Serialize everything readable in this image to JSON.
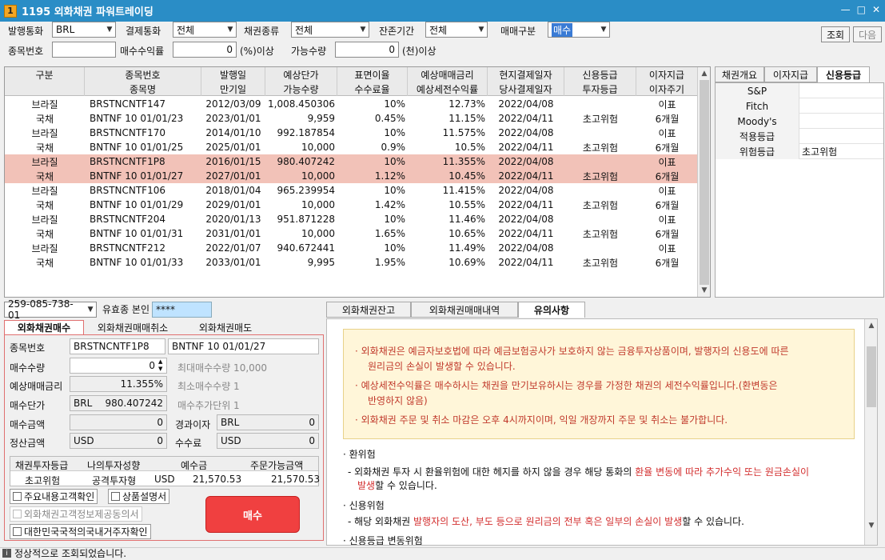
{
  "window": {
    "icon": "1",
    "title": "1195 외화채권 파워트레이딩",
    "minimize": "—",
    "restore": "□",
    "close": "✕"
  },
  "filters": {
    "issue_currency_label": "발행통화",
    "issue_currency_value": "BRL",
    "settle_currency_label": "결제통화",
    "settle_currency_value": "전체",
    "bond_type_label": "채권종류",
    "bond_type_value": "전체",
    "remaining_label": "잔존기간",
    "remaining_value": "전체",
    "trade_type_label": "매매구분",
    "trade_type_value": "매수",
    "code_label": "종목번호",
    "code_value": "",
    "yield_label": "매수수익률",
    "yield_value": "0",
    "yield_unit": "(%)이상",
    "qty_label": "가능수량",
    "qty_value": "0",
    "qty_unit": "(천)이상",
    "search_button": "조회",
    "next_button": "다음"
  },
  "grid": {
    "headers_top": [
      "구분",
      "종목번호",
      "발행일",
      "예상단가",
      "표면이율",
      "예상매매금리",
      "현지결제일자",
      "신용등급",
      "이자지급"
    ],
    "headers_bottom": [
      "",
      "종목명",
      "만기일",
      "가능수량",
      "수수료율",
      "예상세전수익률",
      "당사결제일자",
      "투자등급",
      "이자주기"
    ],
    "rows": [
      {
        "a": [
          "브라질",
          "BRSTNCNTF147",
          "2012/03/09",
          "1,008.450306",
          "10%",
          "12.73%",
          "2022/04/08",
          "",
          "이표"
        ],
        "b": [
          "국채",
          "BNTNF 10 01/01/23",
          "2023/01/01",
          "9,959",
          "0.45%",
          "11.15%",
          "2022/04/11",
          "초고위험",
          "6개월"
        ]
      },
      {
        "a": [
          "브라질",
          "BRSTNCNTF170",
          "2014/01/10",
          "992.187854",
          "10%",
          "11.575%",
          "2022/04/08",
          "",
          "이표"
        ],
        "b": [
          "국채",
          "BNTNF 10 01/01/25",
          "2025/01/01",
          "10,000",
          "0.9%",
          "10.5%",
          "2022/04/11",
          "초고위험",
          "6개월"
        ]
      },
      {
        "a": [
          "브라질",
          "BRSTNCNTF1P8",
          "2016/01/15",
          "980.407242",
          "10%",
          "11.355%",
          "2022/04/08",
          "",
          "이표"
        ],
        "b": [
          "국채",
          "BNTNF 10 01/01/27",
          "2027/01/01",
          "10,000",
          "1.12%",
          "10.45%",
          "2022/04/11",
          "초고위험",
          "6개월"
        ]
      },
      {
        "a": [
          "브라질",
          "BRSTNCNTF106",
          "2018/01/04",
          "965.239954",
          "10%",
          "11.415%",
          "2022/04/08",
          "",
          "이표"
        ],
        "b": [
          "국채",
          "BNTNF 10 01/01/29",
          "2029/01/01",
          "10,000",
          "1.42%",
          "10.55%",
          "2022/04/11",
          "초고위험",
          "6개월"
        ]
      },
      {
        "a": [
          "브라질",
          "BRSTNCNTF204",
          "2020/01/13",
          "951.871228",
          "10%",
          "11.46%",
          "2022/04/08",
          "",
          "이표"
        ],
        "b": [
          "국채",
          "BNTNF 10 01/01/31",
          "2031/01/01",
          "10,000",
          "1.65%",
          "10.65%",
          "2022/04/11",
          "초고위험",
          "6개월"
        ]
      },
      {
        "a": [
          "브라질",
          "BRSTNCNTF212",
          "2022/01/07",
          "940.672441",
          "10%",
          "11.49%",
          "2022/04/08",
          "",
          "이표"
        ],
        "b": [
          "국채",
          "BNTNF 10 01/01/33",
          "2033/01/01",
          "9,995",
          "1.95%",
          "10.69%",
          "2022/04/11",
          "초고위험",
          "6개월"
        ]
      }
    ],
    "selected_index": 2
  },
  "right_tabs": [
    "채권개요",
    "이자지급",
    "신용등급"
  ],
  "rating": [
    {
      "k": "S&P",
      "v": ""
    },
    {
      "k": "Fitch",
      "v": ""
    },
    {
      "k": "Moody's",
      "v": ""
    },
    {
      "k": "적용등급",
      "v": ""
    },
    {
      "k": "위험등급",
      "v": "초고위험"
    }
  ],
  "account": {
    "number": "259-085-738-01",
    "name_label": "유효종 본인",
    "password": "****"
  },
  "order_tabs": [
    "외화채권매수",
    "외화채권매매취소",
    "외화채권매도"
  ],
  "order": {
    "code_label": "종목번호",
    "code": "BRSTNCNTF1P8",
    "name": "BNTNF 10 01/01/27",
    "qty_label": "매수수량",
    "qty": "0",
    "min_qty": "최대매수수량 10,000",
    "rate_label": "예상매매금리",
    "rate": "11.355%",
    "min_unit": "최소매수수량 1",
    "price_label": "매수단가",
    "price_cur": "BRL",
    "price": "980.407242",
    "add_unit": "매수추가단위 1",
    "amount_label": "매수금액",
    "amount": "0",
    "accrued_label": "경과이자",
    "accrued_cur": "BRL",
    "accrued": "0",
    "settle_label": "정산금액",
    "settle_cur": "USD",
    "settle": "0",
    "fee_label": "수수료",
    "fee_cur": "USD",
    "fee": "0",
    "info_headers": [
      "채권투자등급",
      "나의투자성향",
      "예수금",
      "주문가능금액"
    ],
    "info_values": [
      "초고위험",
      "공격투자형",
      "USD",
      "21,570.53",
      "21,570.53"
    ],
    "checks": [
      "주요내용고객확인",
      "상품설명서",
      "외화채권고객정보제공동의서",
      "대한민국국적의국내거주자확인"
    ],
    "buy_button": "매수"
  },
  "bottom_tabs": [
    "외화채권잔고",
    "외화채권매매내역",
    "유의사항"
  ],
  "notice": {
    "warnings": [
      "· 외화채권은 예금자보호법에 따라 예금보험공사가 보호하지 않는 금융투자상품이며, 발행자의 신용도에 따른",
      "원리금의 손실이 발생할 수 있습니다.",
      "· 예상세전수익률은 매수하시는 채권을 만기보유하시는 경우를 가정한 채권의 세전수익률입니다.(환변동은",
      "반영하지 않음)",
      "· 외화채권 주문 및 취소 마감은 오후 4시까지이며, 익일 개장까지 주문 및 취소는 불가합니다."
    ],
    "fx_title": "· 환위험",
    "fx_1a": "- 외화채권 투자 시 환율위험에 대한 헤지를 하지 않을 경우 해당 통화의 ",
    "fx_1b": "환율 변동에 따라 추가수익 또는 원금손실이",
    "fx_2a": "발생",
    "fx_2b": "할 수 있습니다.",
    "credit_title": "· 신용위험",
    "credit_a": "- 해당 외화채권 ",
    "credit_b": "발행자의 도산, 부도 등으로 원리금의 전부 혹은 일부의 손실이 발생",
    "credit_c": "할 수 있습니다.",
    "rating_title": "· 신용등급 변동위험"
  },
  "status": "정상적으로 조회되었습니다."
}
